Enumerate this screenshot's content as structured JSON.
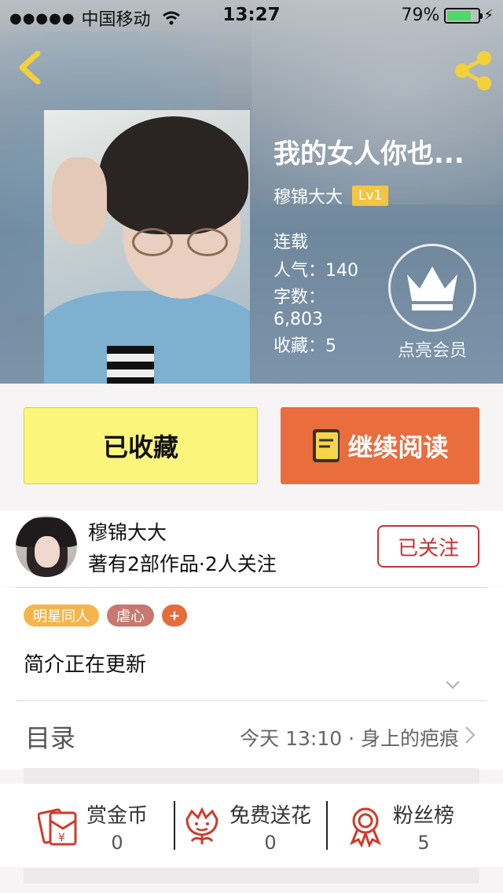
{
  "status_bar": {
    "signal_dots": "●●●●●",
    "carrier": "中国移动",
    "time": "13:27",
    "battery_percent": "79%",
    "battery_level": 0.79
  },
  "header": {
    "back_icon": "chevron-left-icon",
    "share_icon": "share-icon"
  },
  "book": {
    "title": "我的女人你也...",
    "author": "穆锦大大",
    "level": "Lv1",
    "status": "连载",
    "popularity": "人气：140",
    "word_count_label": "字数：",
    "word_count_value": "6,803",
    "favorites": "收藏：5"
  },
  "vip": {
    "label": "点亮会员",
    "icon": "crown-icon"
  },
  "actions": {
    "favorited_label": "已收藏",
    "continue_label": "继续阅读"
  },
  "author_card": {
    "name": "穆锦大大",
    "stats": "著有2部作品·2人关注",
    "follow_label": "已关注"
  },
  "tags": [
    "明星同人",
    "虐心"
  ],
  "tag_add": "+",
  "intro": "简介正在更新",
  "toc": {
    "label": "目录",
    "latest": "今天 13:10 · 身上的疤痕"
  },
  "stats": [
    {
      "label": "赏金币",
      "value": "0",
      "icon": "red-envelope-icon"
    },
    {
      "label": "免费送花",
      "value": "0",
      "icon": "flower-icon"
    },
    {
      "label": "粉丝榜",
      "value": "5",
      "icon": "medal-icon"
    }
  ],
  "colors": {
    "favorite_bg": "#fbf57c",
    "read_bg": "#ea6d3e",
    "follow": "#c93232",
    "level_badge": "#f4c542",
    "icon_red": "#d23a2a"
  }
}
